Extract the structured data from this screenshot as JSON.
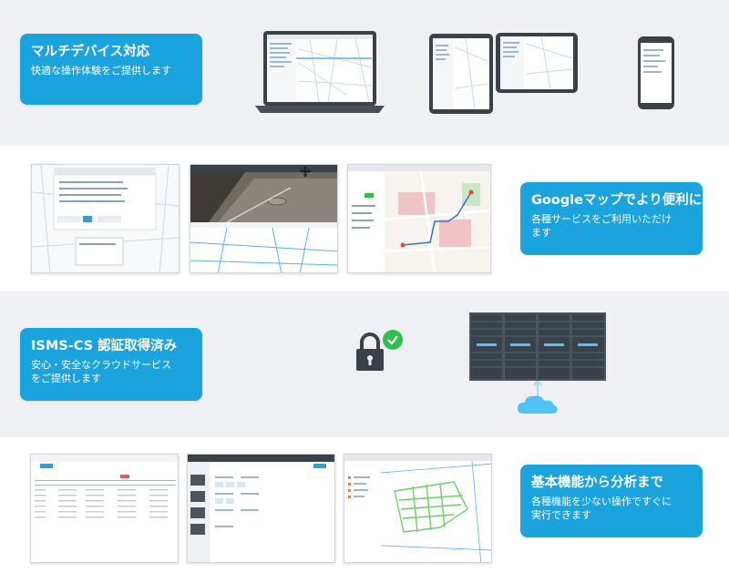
{
  "sections": [
    {
      "title": "マルチデバイス対応",
      "desc": "快適な操作体験をご提供します"
    },
    {
      "title": "Googleマップでより便利に",
      "desc": "各種サービスをご利用いただけ\nます"
    },
    {
      "title": "ISMS-CS 認証取得済み",
      "desc": "安心・安全なクラウドサービス\nをご提供します"
    },
    {
      "title": "基本機能から分析まで",
      "desc": "各種機能を少ない操作ですぐに\n実行できます"
    }
  ],
  "colors": {
    "accent": "#1ba3dd",
    "band_gray": "#eef0f3",
    "check_green": "#2fbf4a",
    "server_dark": "#45505a",
    "server_led": "#4fc3f7",
    "map_road": "#c8d9ea",
    "map_line": "#5ab0e8"
  },
  "icons": [
    "laptop-icon",
    "tablet-icon",
    "phone-icon",
    "padlock-icon",
    "check-icon",
    "server-rack-icon",
    "cloud-upload-icon"
  ]
}
